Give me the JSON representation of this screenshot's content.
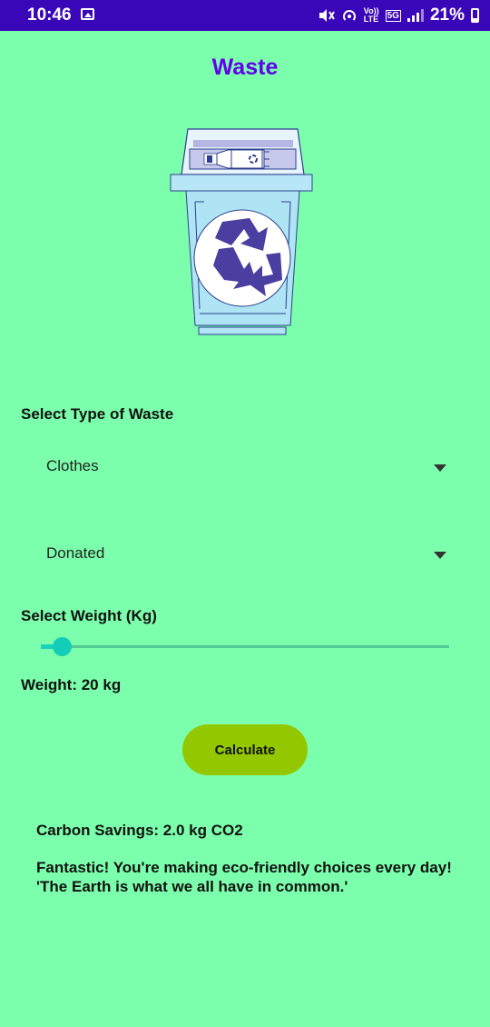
{
  "status_bar": {
    "time": "10:46",
    "network_top": "Vo))",
    "network_bottom": "LTE",
    "badge_5g": "5G",
    "battery_percent": "21%",
    "battery_level": 0.21
  },
  "screen": {
    "title": "Waste"
  },
  "waste_type": {
    "label": "Select Type of Waste",
    "selected": "Clothes"
  },
  "disposal": {
    "selected": "Donated"
  },
  "weight": {
    "label": "Select Weight (Kg)",
    "display": "Weight: 20 kg",
    "slider_value": 20
  },
  "actions": {
    "calculate_label": "Calculate"
  },
  "result": {
    "carbon_savings": "Carbon Savings: 2.0 kg CO2",
    "message_line1": "Fantastic! You're making eco-friendly choices every day!",
    "message_line2": "'The Earth is what we all have in common.'"
  },
  "colors": {
    "background": "#7cffac",
    "status_bar": "#3a07b8",
    "title": "#6200ee",
    "button": "#93c800",
    "slider": "#14cdb8"
  }
}
